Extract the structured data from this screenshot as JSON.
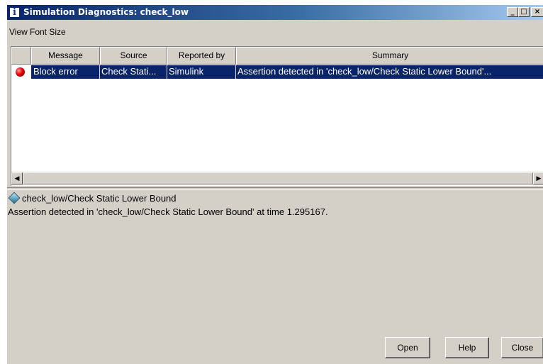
{
  "window": {
    "title": "Simulation Diagnostics: check_low",
    "title_icon_glyph": "i",
    "minimize_glyph": "_",
    "maximize_glyph": "□",
    "close_glyph": "×"
  },
  "menu": {
    "items": [
      "View",
      "Font Size"
    ]
  },
  "table": {
    "columns": [
      "",
      "Message",
      "Source",
      "Reported by",
      "Summary"
    ],
    "rows": [
      {
        "icon": "red-error-dot-icon",
        "message": "Block error",
        "source": "Check Stati...",
        "reported_by": "Simulink",
        "summary": "Assertion detected in 'check_low/Check Static  Lower Bound'..."
      }
    ],
    "selected_row": 0
  },
  "scrollbar": {
    "left_glyph": "◀",
    "right_glyph": "▶"
  },
  "detail": {
    "path": "check_low/Check Static  Lower Bound",
    "message": "Assertion detected in 'check_low/Check Static  Lower Bound' at time 1.295167."
  },
  "buttons": {
    "open": "Open",
    "help": "Help",
    "close": "Close"
  },
  "colors": {
    "title_bar": "#0a246a",
    "selection": "#0a246a",
    "window_bg": "#d4d0c8",
    "error": "#e00000"
  }
}
